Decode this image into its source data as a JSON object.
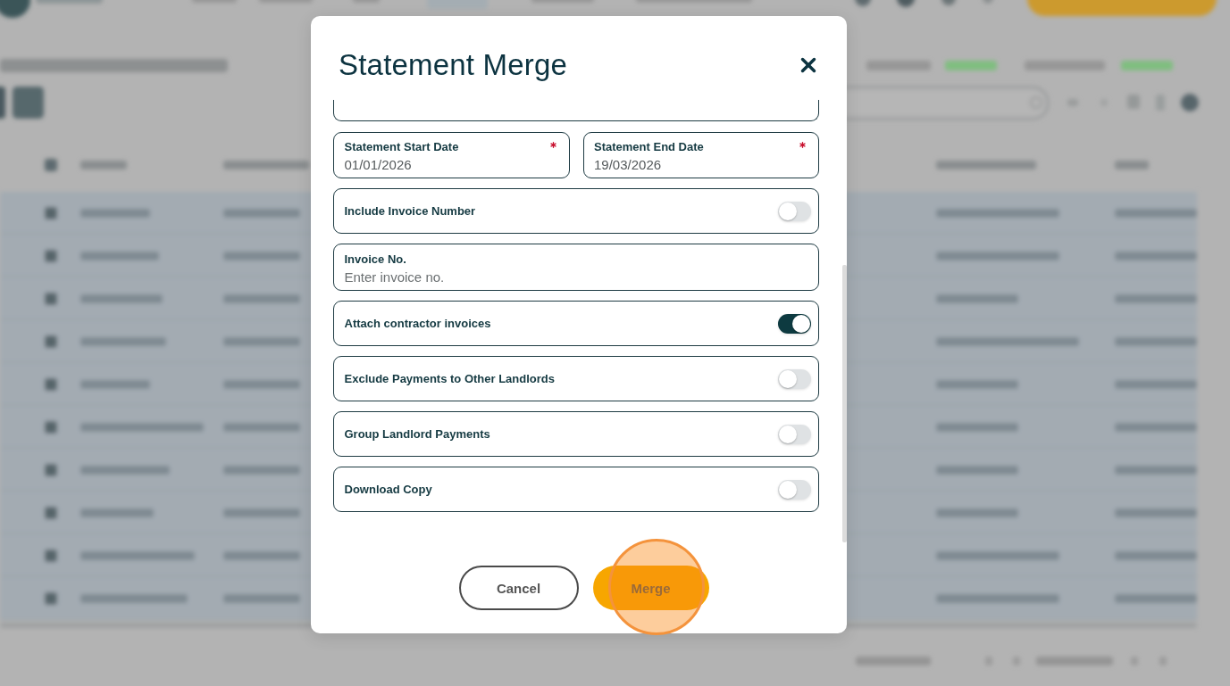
{
  "dialog": {
    "title": "Statement Merge",
    "fields": [
      {
        "kind": "cut_off"
      },
      {
        "kind": "date_pair",
        "dates": [
          {
            "label": "Statement Start Date",
            "value": "01/01/2026",
            "required": true
          },
          {
            "label": "Statement End Date",
            "value": "19/03/2026",
            "required": true
          }
        ]
      },
      {
        "kind": "toggle",
        "label": "Include Invoice Number",
        "on": false
      },
      {
        "kind": "text",
        "label": "Invoice No.",
        "placeholder": "Enter invoice no."
      },
      {
        "kind": "toggle",
        "label": "Attach contractor invoices",
        "on": true
      },
      {
        "kind": "toggle",
        "label": "Exclude Payments to Other Landlords",
        "on": false
      },
      {
        "kind": "toggle",
        "label": "Group Landlord Payments",
        "on": false
      },
      {
        "kind": "toggle",
        "label": "Download Copy",
        "on": false
      }
    ],
    "buttons": [
      {
        "kind": "secondary",
        "label": "Cancel",
        "highlighted": false
      },
      {
        "kind": "primary",
        "label": "Merge",
        "highlighted": true
      }
    ]
  }
}
